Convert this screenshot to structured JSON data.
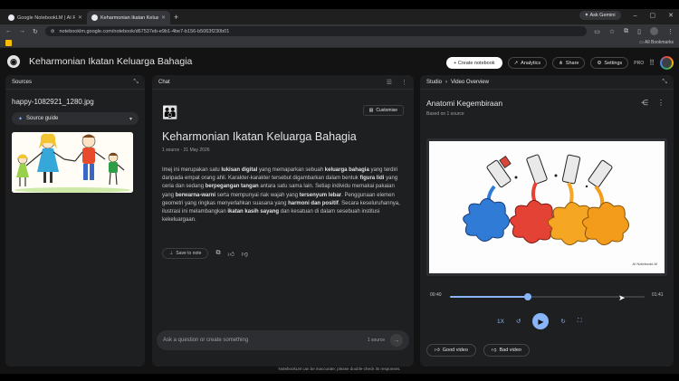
{
  "browser": {
    "tabs": [
      {
        "title": "Google NotebookLM | AI Rese..."
      },
      {
        "title": "Keharmonian Ikatan Keluar..."
      }
    ],
    "gemini_label": "Ask Gemini",
    "url": "notebooklm.google.com/notebook/d67537eb-e9b1-4be7-b156-b5063f230b01",
    "all_bookmarks": "All Bookmarks"
  },
  "header": {
    "logo": "◉",
    "title": "Keharmonian Ikatan Keluarga Bahagia",
    "create_label": "+ Create notebook",
    "analytics_label": "Analytics",
    "share_label": "Share",
    "settings_label": "Settings",
    "pro_label": "PRO"
  },
  "sources": {
    "heading": "Sources",
    "file_name": "happy-1082921_1280.jpg",
    "guide_label": "Source guide"
  },
  "chat": {
    "heading": "Chat",
    "customise_label": "Customise",
    "title": "Keharmonian Ikatan Keluarga Bahagia",
    "meta": "1 source · 21 May 2026",
    "body": [
      {
        "t": "Imej ini merupakan satu ",
        "b": false
      },
      {
        "t": "lukisan digital",
        "b": true
      },
      {
        "t": " yang memaparkan sebuah ",
        "b": false
      },
      {
        "t": "keluarga bahagia",
        "b": true
      },
      {
        "t": " yang terdiri daripada empat orang ahli. Karakter-karakter tersebut digambarkan dalam bentuk ",
        "b": false
      },
      {
        "t": "figura lidi",
        "b": true
      },
      {
        "t": " yang ceria dan sedang ",
        "b": false
      },
      {
        "t": "berpegangan tangan",
        "b": true
      },
      {
        "t": " antara satu sama lain. Setiap individu memakai pakaian yang ",
        "b": false
      },
      {
        "t": "berwarna-warni",
        "b": true
      },
      {
        "t": " serta mempunyai riak wajah yang ",
        "b": false
      },
      {
        "t": "tersenyum lebar",
        "b": true
      },
      {
        "t": ". Penggunaan elemen geometri yang ringkas menyerlahkan suasana yang ",
        "b": false
      },
      {
        "t": "harmoni dan positif",
        "b": true
      },
      {
        "t": ". Secara keseluruhannya, ilustrasi ini melambangkan ",
        "b": false
      },
      {
        "t": "ikatan kasih sayang",
        "b": true
      },
      {
        "t": " dan kesatuan di dalam sesebuah institusi kekeluargaan.",
        "b": false
      }
    ],
    "save_label": "Save to note",
    "input_placeholder": "Ask a question or create something",
    "source_count": "1 source"
  },
  "studio": {
    "heading": "Studio",
    "crumb": "Video Overview",
    "title": "Anatomi Kegembiraan",
    "subtitle": "Based on 1 source",
    "watermark": "AI NotebookLM",
    "time_current": "00:40",
    "time_total": "01:41",
    "progress": 0.4,
    "speed_label": "1X",
    "good_label": "Good video",
    "bad_label": "Bad video"
  },
  "disclaimer": "NotebookLM can be inaccurate; please double-check its responses.",
  "colors": {
    "accent": "#8ab4f8",
    "panel": "#1e1f20",
    "background": "#131314"
  }
}
